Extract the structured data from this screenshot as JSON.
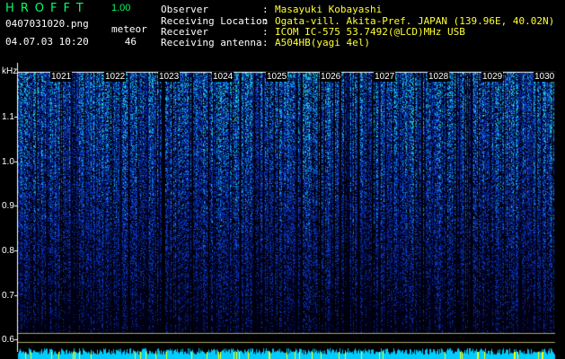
{
  "header": {
    "logo": "HROFFT",
    "version": "1.00",
    "filename": "0407031020.png",
    "datetime": "04.07.03 10:20",
    "meteor_label": "meteor",
    "meteor_count": "46"
  },
  "info": [
    {
      "key": "Observer",
      "value": "Masayuki Kobayashi"
    },
    {
      "key": "Receiving Location",
      "value": "Ogata-vill. Akita-Pref. JAPAN (139.96E, 40.02N)"
    },
    {
      "key": "Receiver",
      "value": "ICOM IC-575 53.7492(@LCD)MHz USB"
    },
    {
      "key": "Receiving antenna",
      "value": "A504HB(yagi 4el)"
    }
  ],
  "spectrogram": {
    "y_unit": "kHz",
    "y_ticks": [
      "1.1",
      "1.0",
      "0.9",
      "0.8",
      "0.7",
      "0.6"
    ],
    "x_ticks": [
      "1021",
      "1022",
      "1023",
      "1024",
      "1025",
      "1026",
      "1027",
      "1028",
      "1029",
      "1030"
    ],
    "colors": {
      "background": "#000000",
      "signal_low": "#0a1a8c",
      "signal_high": "#00ff99",
      "baseline": "#00ccff",
      "tick": "#ffff00"
    }
  }
}
